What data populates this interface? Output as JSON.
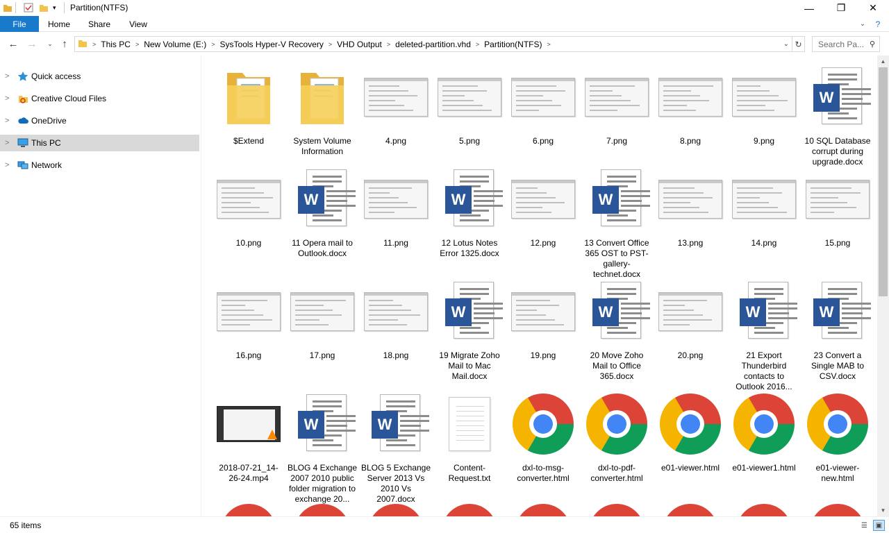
{
  "window": {
    "title": "Partition(NTFS)"
  },
  "ribbon": {
    "tabs": [
      "File",
      "Home",
      "Share",
      "View"
    ]
  },
  "address": {
    "crumbs": [
      "This PC",
      "New Volume (E:)",
      "SysTools Hyper-V Recovery",
      "VHD Output",
      "deleted-partition.vhd",
      "Partition(NTFS)"
    ],
    "search_placeholder": "Search Pa..."
  },
  "nav": {
    "items": [
      {
        "label": "Quick access",
        "icon": "star-icon"
      },
      {
        "label": "Creative Cloud Files",
        "icon": "creative-cloud-icon"
      },
      {
        "label": "OneDrive",
        "icon": "cloud-icon"
      },
      {
        "label": "This PC",
        "icon": "computer-icon",
        "selected": true
      },
      {
        "label": "Network",
        "icon": "network-icon"
      }
    ]
  },
  "files": [
    {
      "name": "$Extend",
      "kind": "folder"
    },
    {
      "name": "System Volume Information",
      "kind": "folder"
    },
    {
      "name": "4.png",
      "kind": "image"
    },
    {
      "name": "5.png",
      "kind": "image"
    },
    {
      "name": "6.png",
      "kind": "image"
    },
    {
      "name": "7.png",
      "kind": "image"
    },
    {
      "name": "8.png",
      "kind": "image"
    },
    {
      "name": "9.png",
      "kind": "image"
    },
    {
      "name": "10 SQL Database corrupt during upgrade.docx",
      "kind": "docx"
    },
    {
      "name": "10.png",
      "kind": "image"
    },
    {
      "name": "11 Opera mail to Outlook.docx",
      "kind": "docx"
    },
    {
      "name": "11.png",
      "kind": "image"
    },
    {
      "name": "12 Lotus Notes Error 1325.docx",
      "kind": "docx"
    },
    {
      "name": "12.png",
      "kind": "image"
    },
    {
      "name": "13 Convert Office 365 OST to PST-gallery-technet.docx",
      "kind": "docx"
    },
    {
      "name": "13.png",
      "kind": "image"
    },
    {
      "name": "14.png",
      "kind": "image"
    },
    {
      "name": "15.png",
      "kind": "image"
    },
    {
      "name": "16.png",
      "kind": "image"
    },
    {
      "name": "17.png",
      "kind": "image"
    },
    {
      "name": "18.png",
      "kind": "image"
    },
    {
      "name": "19 Migrate Zoho Mail to Mac Mail.docx",
      "kind": "docx"
    },
    {
      "name": "19.png",
      "kind": "image"
    },
    {
      "name": "20 Move Zoho Mail to Office 365.docx",
      "kind": "docx"
    },
    {
      "name": "20.png",
      "kind": "image"
    },
    {
      "name": "21 Export Thunderbird contacts to Outlook 2016...",
      "kind": "docx"
    },
    {
      "name": "23 Convert a Single MAB to CSV.docx",
      "kind": "docx"
    },
    {
      "name": "2018-07-21_14-26-24.mp4",
      "kind": "video"
    },
    {
      "name": "BLOG 4 Exchange 2007 2010 public folder migration to exchange 20...",
      "kind": "docx"
    },
    {
      "name": "BLOG 5 Exchange Server 2013 Vs 2010 Vs 2007.docx",
      "kind": "docx"
    },
    {
      "name": "Content-Request.txt",
      "kind": "txt"
    },
    {
      "name": "dxl-to-msg-converter.html",
      "kind": "html"
    },
    {
      "name": "dxl-to-pdf-converter.html",
      "kind": "html"
    },
    {
      "name": "e01-viewer.html",
      "kind": "html"
    },
    {
      "name": "e01-viewer1.html",
      "kind": "html"
    },
    {
      "name": "e01-viewer-new.html",
      "kind": "html"
    }
  ],
  "status": {
    "count": "65 items"
  },
  "colors": {
    "file_tab": "#1979ca",
    "selected_nav": "#d9d9d9",
    "word_blue": "#2a5699"
  }
}
